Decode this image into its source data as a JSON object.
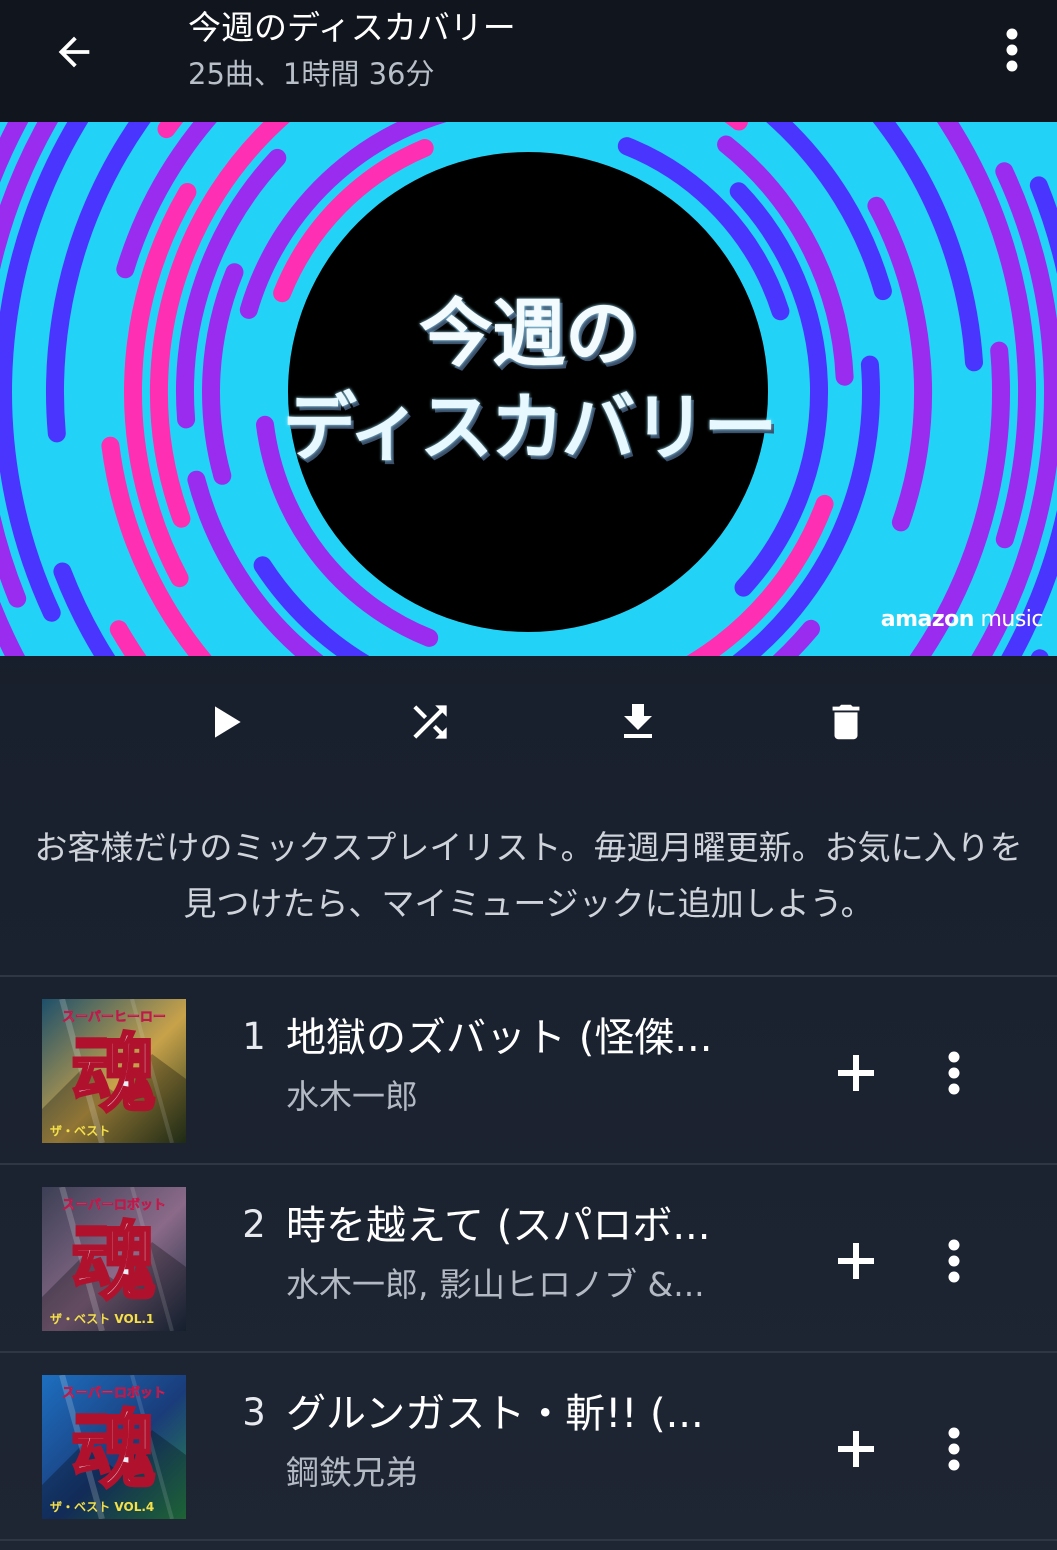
{
  "header": {
    "title": "今週のディスカバリー",
    "subtitle": "25曲、1時間 36分",
    "back_icon": "arrow-left-icon",
    "more_icon": "more-vertical-icon"
  },
  "hero": {
    "line1": "今週の",
    "line2": "ディスカバリー",
    "brand_bold": "amazon",
    "brand_thin": " music",
    "colors": {
      "cyan": "#23d3f7",
      "magenta": "#ff2fb3",
      "blue": "#4a35ff",
      "purple": "#9a2cf0",
      "center": "#000000"
    }
  },
  "actions": [
    {
      "icon": "play-icon"
    },
    {
      "icon": "shuffle-icon"
    },
    {
      "icon": "download-icon"
    },
    {
      "icon": "trash-icon"
    }
  ],
  "description": "お客様だけのミックスプレイリスト。毎週月曜更新。お気に入りを見つけたら、マイミュージックに追加しよう。",
  "tracks": [
    {
      "number": "1",
      "title": "地獄のズバット (怪傑...",
      "artist": "水木一郎",
      "art_top": "スーパーヒーロー",
      "art_main": "魂",
      "art_bottom": "ザ・ベスト",
      "art_colors": [
        "#1c4f6b",
        "#c8a24a",
        "#2a3b1e"
      ]
    },
    {
      "number": "2",
      "title": "時を越えて (スパロボ...",
      "artist": "水木一郎, 影山ヒロノブ &...",
      "art_top": "スーパーロボット",
      "art_main": "魂",
      "art_bottom": "ザ・ベスト VOL.1",
      "art_colors": [
        "#3b3f55",
        "#8a6a88",
        "#1c2c40"
      ]
    },
    {
      "number": "3",
      "title": "グルンガスト・斬!! (...",
      "artist": "鋼鉄兄弟",
      "art_top": "スーパーロボット",
      "art_main": "魂",
      "art_bottom": "ザ・ベスト VOL.4",
      "art_colors": [
        "#1d6fc0",
        "#1a3c7a",
        "#2a8a4a"
      ]
    }
  ]
}
